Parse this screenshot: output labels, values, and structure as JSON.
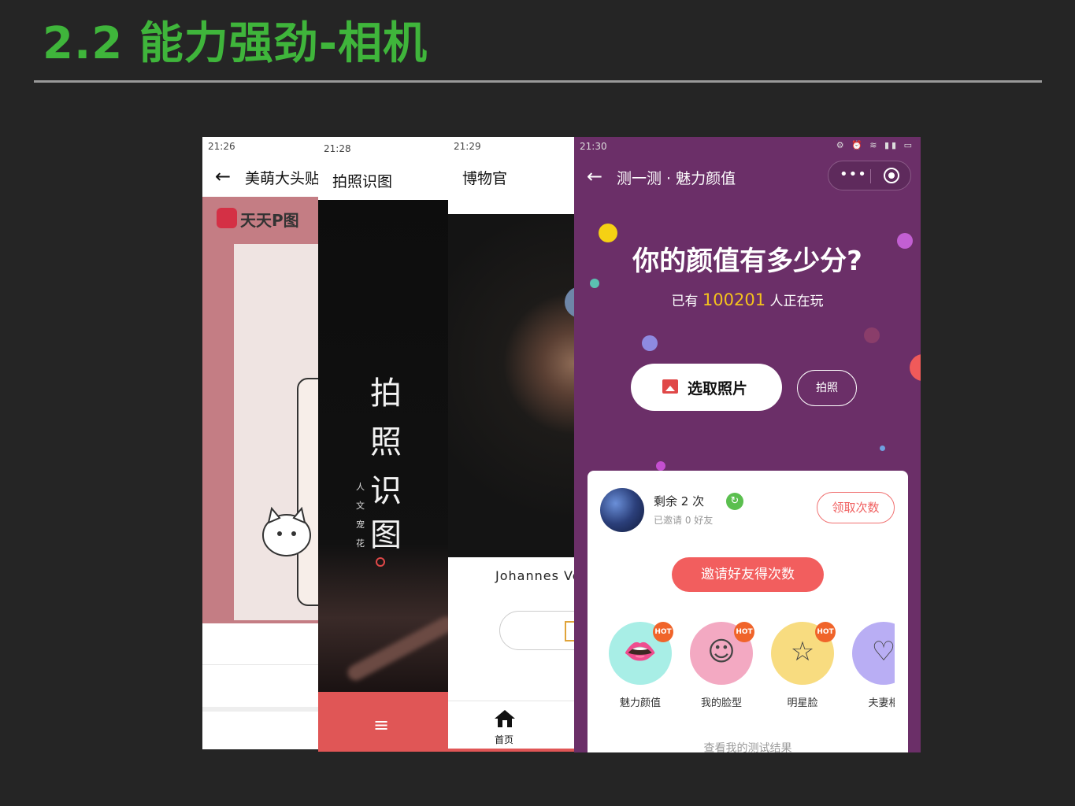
{
  "slide": {
    "title": "2.2 能力强劲-相机"
  },
  "phone1": {
    "time": "21:26",
    "nav_title": "美萌大头贴",
    "brand": "天天P图"
  },
  "phone2": {
    "time": "21:28",
    "nav_title": "拍照识图",
    "poster_chars": [
      "拍",
      "照",
      "识",
      "图"
    ],
    "poster_sub": [
      "人",
      "文",
      "宠",
      "花"
    ],
    "menu_icon": "≡"
  },
  "phone3": {
    "time": "21:29",
    "nav_title": "博物官",
    "caption": "Johannes Ve",
    "tab_home_label": "首页"
  },
  "phone4": {
    "time": "21:30",
    "status_icons": "⚙ ⏰ ≋ ▮▮ ▭",
    "back_icon": "←",
    "nav_title": "测一测 · 魅力颜值",
    "more_icon": "•••",
    "headline": "你的颜值有多少分?",
    "players_prefix": "已有",
    "players_count": "100201",
    "players_suffix": "人正在玩",
    "pick_photo_label": "选取照片",
    "shoot_label": "拍照",
    "remaining_label": "剩余 2 次",
    "invited_label": "已邀请 0 好友",
    "refresh_icon": "↻",
    "claim_label": "领取次数",
    "invite_label": "邀请好友得次数",
    "categories": [
      {
        "label": "魅力颜值",
        "icon": "lips",
        "glyph": "👄",
        "hot": "HOT",
        "color": "#a8eee6"
      },
      {
        "label": "我的脸型",
        "icon": "smiley",
        "glyph": "☺",
        "hot": "HOT",
        "color": "#f3a9c2"
      },
      {
        "label": "明星脸",
        "icon": "star",
        "glyph": "☆",
        "hot": "HOT",
        "color": "#f8dc80"
      },
      {
        "label": "夫妻相",
        "icon": "heart",
        "glyph": "♡",
        "hot": "",
        "color": "#b9aef4"
      }
    ],
    "results_link": "查看我的测试结果"
  }
}
